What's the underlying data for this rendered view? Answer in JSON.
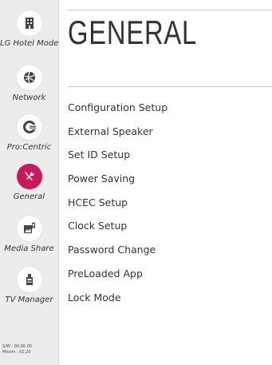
{
  "sidebar": {
    "items": [
      {
        "label": "LG Hotel Mode",
        "icon": "hotel-icon",
        "active": false
      },
      {
        "label": "Network",
        "icon": "globe-icon",
        "active": false
      },
      {
        "label": "Pro:Centric",
        "icon": "procentric-icon",
        "active": false
      },
      {
        "label": "General",
        "icon": "tools-icon",
        "active": true
      },
      {
        "label": "Media Share",
        "icon": "media-share-icon",
        "active": false
      },
      {
        "label": "TV Manager",
        "icon": "tv-manager-icon",
        "active": false
      }
    ],
    "version": {
      "sw": "S/W : 00.00.00",
      "micom": "Micom : 01.20"
    }
  },
  "main": {
    "title": "GENERAL",
    "menu": [
      "Configuration Setup",
      "External Speaker",
      "Set ID Setup",
      "Power Saving",
      "HCEC Setup",
      "Clock Setup",
      "Password Change",
      "PreLoaded App",
      "Lock Mode"
    ]
  },
  "colors": {
    "accent": "#c8195c",
    "sidebar_bg": "#ececec",
    "text": "#333333"
  }
}
